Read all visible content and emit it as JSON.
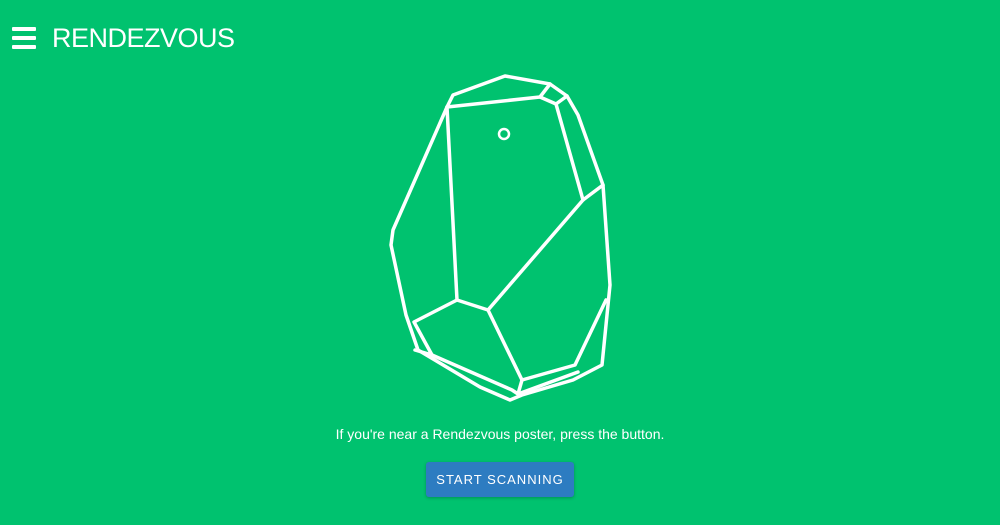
{
  "header": {
    "menu_icon": "hamburger-menu-icon",
    "title": "RENDEZVOUS"
  },
  "illustration": {
    "icon": "estimote-beacon-icon"
  },
  "main": {
    "instruction": "If you're near a Rendezvous poster, press the button.",
    "scan_button_label": "START SCANNING"
  },
  "colors": {
    "background": "#00c26f",
    "button": "#2d7cc1",
    "foreground": "#ffffff"
  }
}
